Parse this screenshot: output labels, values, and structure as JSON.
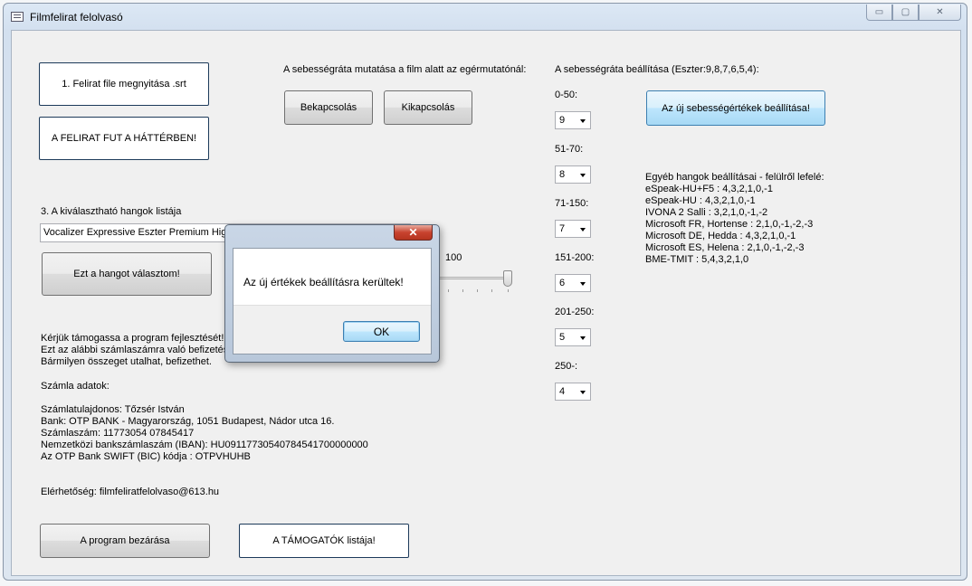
{
  "window": {
    "title": "Filmfelirat felolvasó",
    "controls": [
      "▭",
      "▢",
      "✕"
    ]
  },
  "left": {
    "open_button": "1.  Felirat file megnyitása .srt",
    "background_button": "A FELIRAT FUT A HÁTTÉRBEN!",
    "voices_label": "3.  A kiválasztható hangok listája",
    "voice_value": "Vocalizer Expressive Eszter Premium High 22kHz",
    "choose_voice_button": "Ezt a hangot választom!",
    "slider_value": "100",
    "support_lines": [
      "Kérjük támogassa a program fejlesztését!",
      "Ezt az alábbi számlaszámra való befizetéssel teheti meg.",
      "Bármilyen összeget utalhat, befizethet."
    ],
    "account_heading": "Számla adatok:",
    "account_lines": [
      "Számlatulajdonos: Tőzsér István",
      "Bank: OTP BANK - Magyarország, 1051 Budapest, Nádor utca 16.",
      "Számlaszám: 11773054 07845417",
      "Nemzetközi bankszámlaszám (IBAN): HU09117730540784541700000000",
      "Az OTP Bank SWIFT (BIC) kódja : OTPVHUHB"
    ],
    "contact": "Elérhetőség: filmfeliratfelolvaso@613.hu",
    "close_button": "A program bezárása",
    "supporters_button": "A TÁMOGATÓK listája!"
  },
  "middle": {
    "speed_show_label": "A sebességráta mutatása a film alatt az egérmutatónál:",
    "on_button": "Bekapcsolás",
    "off_button": "Kikapcsolás"
  },
  "right": {
    "speed_settings_label": "A sebességráta beállítása (Eszter:9,8,7,6,5,4):",
    "ranges": [
      {
        "label": "0-50:",
        "value": "9"
      },
      {
        "label": "51-70:",
        "value": "8"
      },
      {
        "label": "71-150:",
        "value": "7"
      },
      {
        "label": "151-200:",
        "value": "6"
      },
      {
        "label": "201-250:",
        "value": "5"
      },
      {
        "label": "250-:",
        "value": "4"
      }
    ],
    "apply_button": "Az új sebességértékek beállítása!",
    "other_voices": [
      "Egyéb hangok beállításai - felülről lefelé:",
      "eSpeak-HU+F5 : 4,3,2,1,0,-1",
      "eSpeak-HU : 4,3,2,1,0,-1",
      "IVONA 2 Salli : 3,2,1,0,-1,-2",
      "Microsoft FR, Hortense : 2,1,0,-1,-2,-3",
      "Microsoft DE, Hedda : 4,3,2,1,0,-1",
      "Microsoft ES, Helena : 2,1,0,-1,-2,-3",
      "BME-TMIT : 5,4,3,2,1,0"
    ]
  },
  "dialog": {
    "close_glyph": "✕",
    "message": "Az új értékek beállításra kerültek!",
    "ok_button": "OK"
  }
}
